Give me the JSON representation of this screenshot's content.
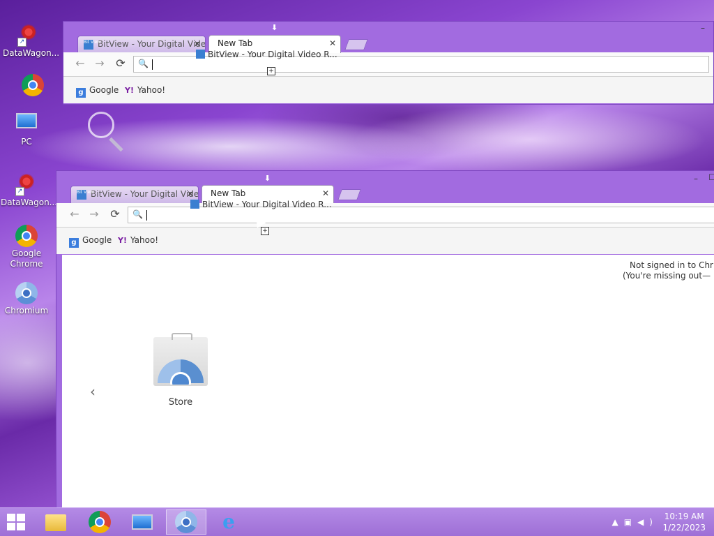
{
  "desktop": {
    "icons": [
      {
        "label": "DataWagon..."
      },
      {
        "label": "PC"
      },
      {
        "label": "DataWagon..."
      },
      {
        "label": "Google Chrome"
      },
      {
        "label": "Chromium"
      }
    ]
  },
  "browser": {
    "tabs": [
      {
        "label": "BitView - Your Digital Vide",
        "favicon_text": "Bit View"
      },
      {
        "label": "New Tab"
      }
    ],
    "dragged_tab_label": "BitView - Your Digital Video R...",
    "omnibox": {
      "value": "",
      "placeholder": ""
    },
    "bookmarks": [
      {
        "label": "Google",
        "icon": "google-icon"
      },
      {
        "label": "Yahoo!",
        "icon": "yahoo-icon"
      }
    ],
    "signin_line1": "Not signed in to Chr",
    "signin_line2": "(You're missing out—",
    "apps": [
      {
        "label": "Store"
      }
    ],
    "pager_prev": "‹"
  },
  "taskbar": {
    "time": "10:19 AM",
    "date": "1/22/2023",
    "apps": [
      "file-explorer",
      "google-chrome",
      "pc-network",
      "chromium",
      "internet-explorer"
    ]
  },
  "colors": {
    "accent": "#a26be0",
    "taskbar": "#a97be0"
  }
}
